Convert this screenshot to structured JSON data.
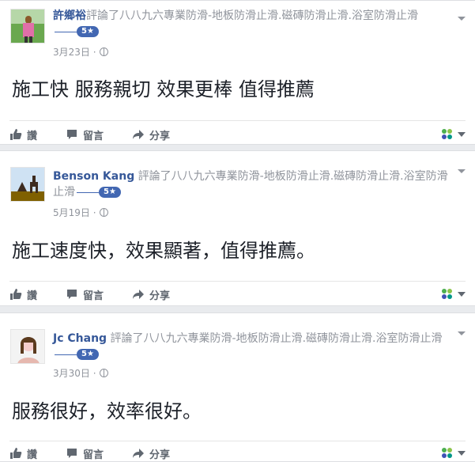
{
  "posts": [
    {
      "author": "許鄉裕",
      "verb": "評論了",
      "page": "八八九六專業防滑-地板防滑止滑.磁磚防滑止滑.浴室防滑止滑",
      "rating": "5★",
      "date": "3月23日 ·",
      "text": "施工快 服務親切 效果更棒 值得推薦"
    },
    {
      "author": "Benson Kang",
      "verb": "評論了",
      "page": "八八九六專業防滑-地板防滑止滑.磁磚防滑止滑.浴室防滑止滑",
      "rating": "5★",
      "date": "5月19日 ·",
      "text": "施工速度快，效果顯著，值得推薦。"
    },
    {
      "author": "Jc Chang",
      "verb": "評論了",
      "page": "八八九六專業防滑-地板防滑止滑.磁磚防滑止滑.浴室防滑止滑",
      "rating": "5★",
      "date": "3月30日 ·",
      "text": "服務很好，效率很好。"
    }
  ],
  "actions": {
    "like": "讚",
    "comment": "留言",
    "share": "分享"
  },
  "icons": [
    "like-icon",
    "comment-icon",
    "share-icon",
    "globe-icon",
    "chevron-down-icon"
  ],
  "colors": {
    "author": "#365899",
    "badge": "#4267b2",
    "meta": "#90949c",
    "background": "#e9ebee"
  }
}
